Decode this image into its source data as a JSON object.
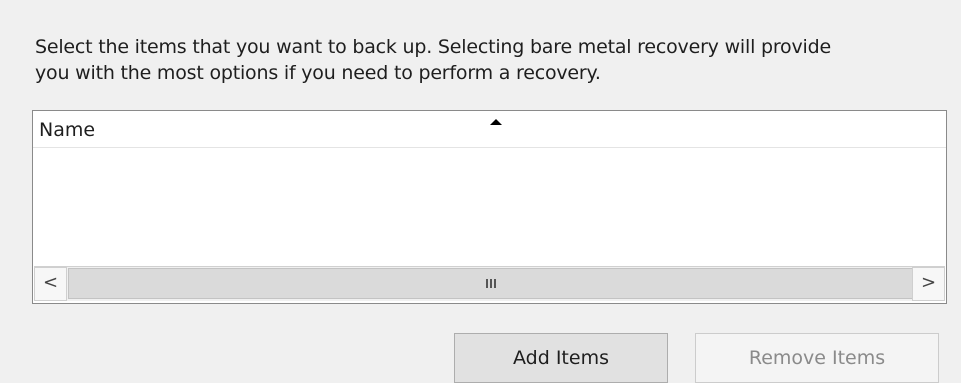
{
  "instructions": {
    "line1": "Select the items that you want to back up. Selecting bare metal recovery will provide",
    "line2": "you with the most options if you need to perform a recovery."
  },
  "list": {
    "column_header": "Name",
    "sort_direction": "ascending",
    "items": []
  },
  "scrollbar": {
    "left_arrow": "<",
    "right_arrow": ">",
    "grip_icon": "scrollbar-grip-icon"
  },
  "buttons": {
    "add_items": "Add Items",
    "remove_items": "Remove Items",
    "remove_items_enabled": false
  },
  "colors": {
    "background": "#f0f0f0",
    "list_background": "#ffffff",
    "disabled_text": "#8a8a8a"
  }
}
